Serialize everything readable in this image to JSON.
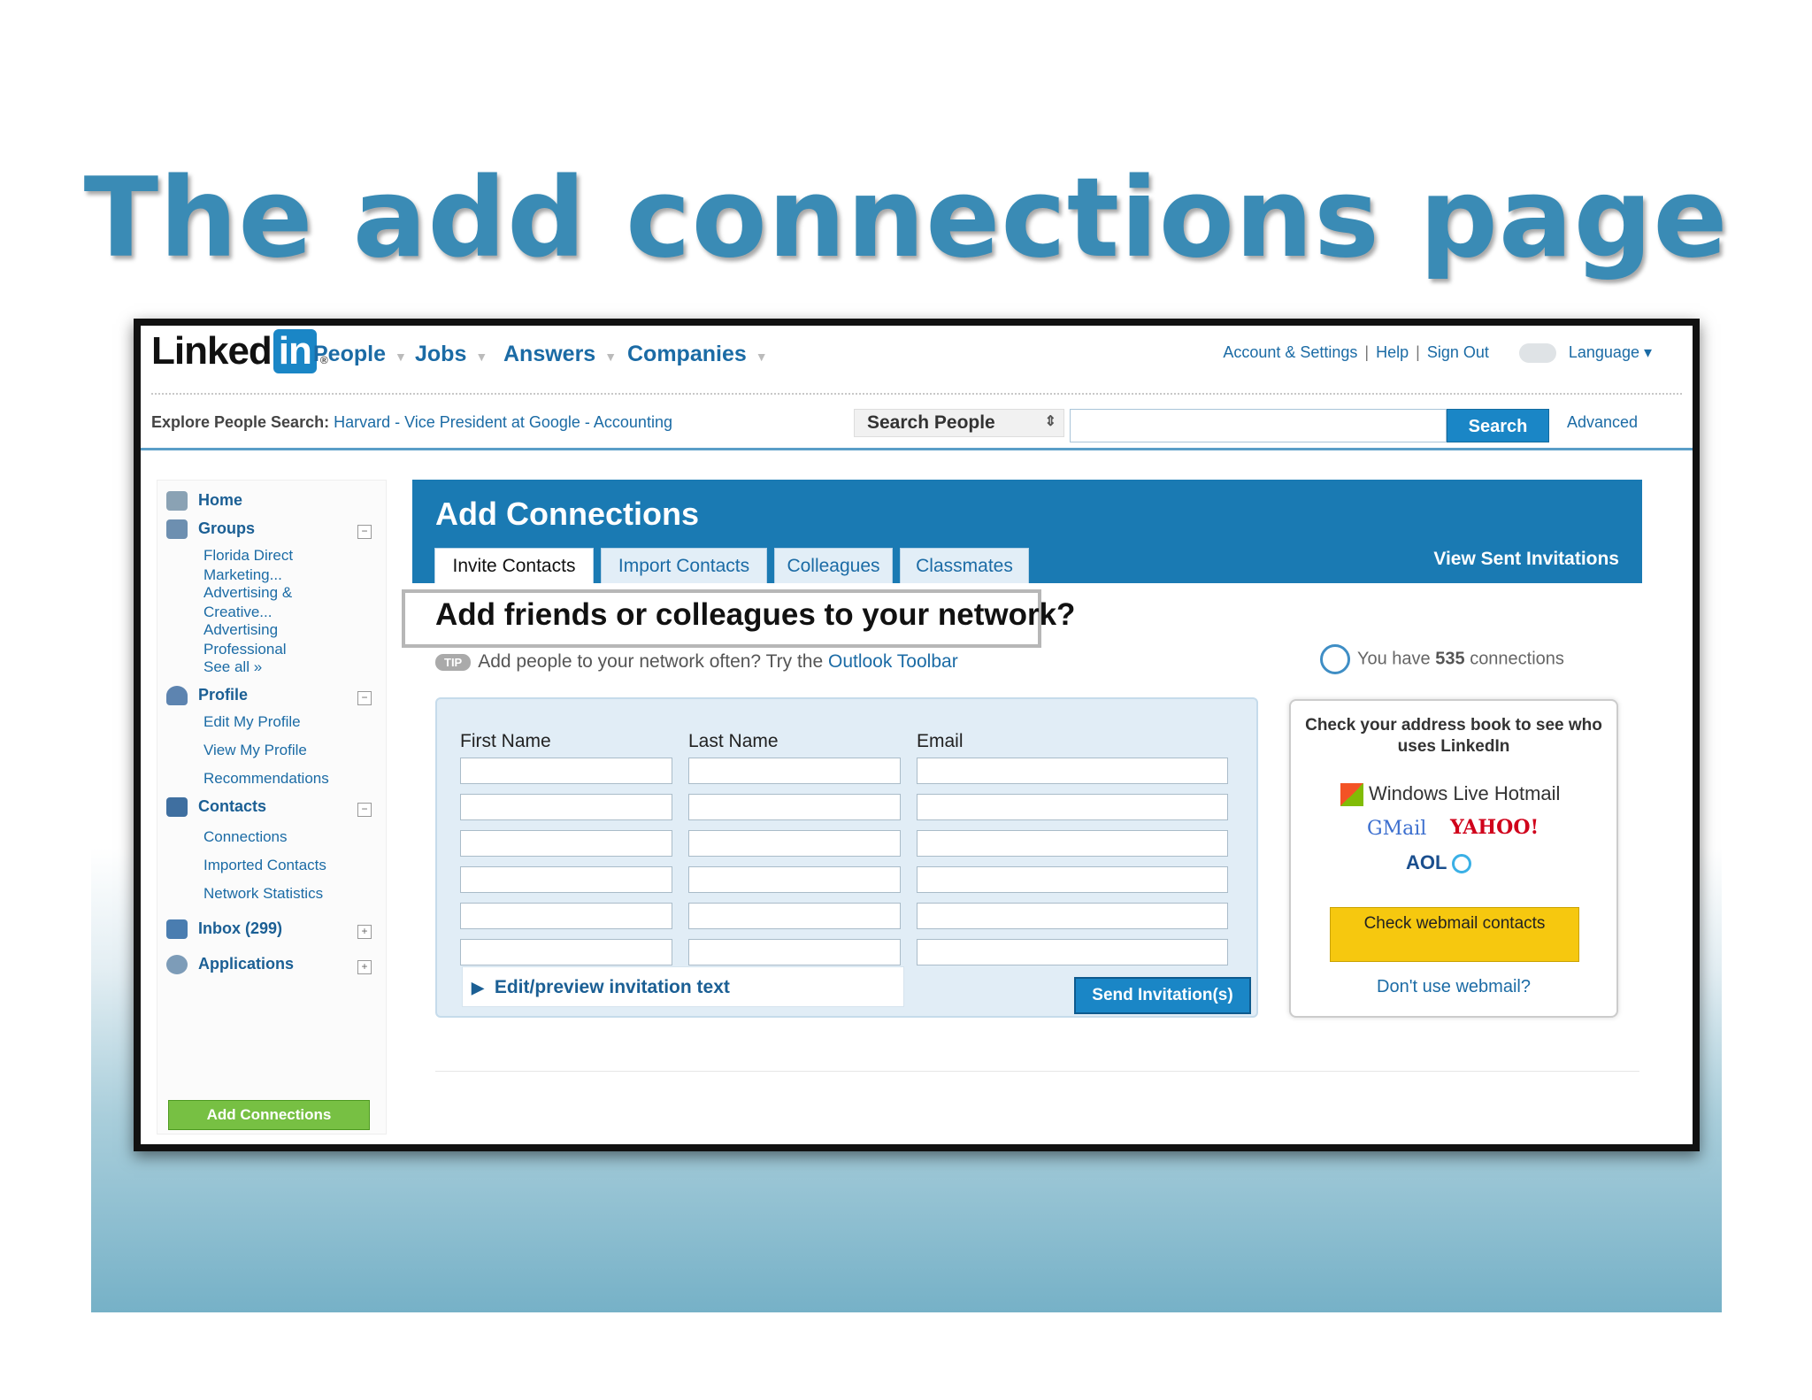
{
  "slide": {
    "title": "The add connections page"
  },
  "topnav": {
    "logo_text": "Linked",
    "logo_in": "in",
    "logo_reg": "®",
    "menus": [
      "People",
      "Jobs",
      "Answers",
      "Companies"
    ],
    "account_links": [
      "Account & Settings",
      "Help",
      "Sign Out"
    ],
    "separator": "|",
    "language": "Language ▾"
  },
  "searchbar": {
    "explore_label": "Explore People Search:",
    "explore_links": "Harvard - Vice President at Google - Accounting",
    "select_value": "Search People",
    "search_button": "Search",
    "advanced": "Advanced"
  },
  "leftnav": {
    "home": "Home",
    "groups": "Groups",
    "group_items": [
      "Florida Direct Marketing...",
      "Advertising & Creative...",
      "Advertising Professional",
      "See all »"
    ],
    "profile": "Profile",
    "profile_items": [
      "Edit My Profile",
      "View My Profile",
      "Recommendations"
    ],
    "contacts": "Contacts",
    "contact_items": [
      "Connections",
      "Imported Contacts",
      "Network Statistics"
    ],
    "inbox": "Inbox (299)",
    "applications": "Applications",
    "collapse": "−",
    "expand": "+",
    "add_connections_button": "Add Connections"
  },
  "main": {
    "banner_title": "Add Connections",
    "view_sent": "View Sent Invitations",
    "tabs": [
      "Invite Contacts",
      "Import Contacts",
      "Colleagues",
      "Classmates"
    ],
    "heading": "Add friends or colleagues to your network?",
    "tip_badge": "TIP",
    "tip_text": "Add people to your network often? Try the",
    "tip_link": "Outlook Toolbar",
    "connections_prefix": "You have",
    "connections_count": "535",
    "connections_suffix": "connections",
    "form": {
      "columns": [
        "First Name",
        "Last Name",
        "Email"
      ],
      "rows": 6,
      "edit_preview": "Edit/preview invitation text",
      "send_button": "Send Invitation(s)"
    },
    "webmail": {
      "heading": "Check your address book to see who uses LinkedIn",
      "providers": [
        "Windows Live Hotmail",
        "GMail",
        "YAHOO!",
        "AOL"
      ],
      "check_button": "Check webmail contacts",
      "dont_use": "Don't use webmail?"
    }
  },
  "colors": {
    "title_blue": "#3a8bb5",
    "linkedin_blue": "#1a7ab3",
    "link_blue": "#1b6ba5",
    "green_button": "#77c043",
    "yellow_button": "#f6c80f"
  }
}
